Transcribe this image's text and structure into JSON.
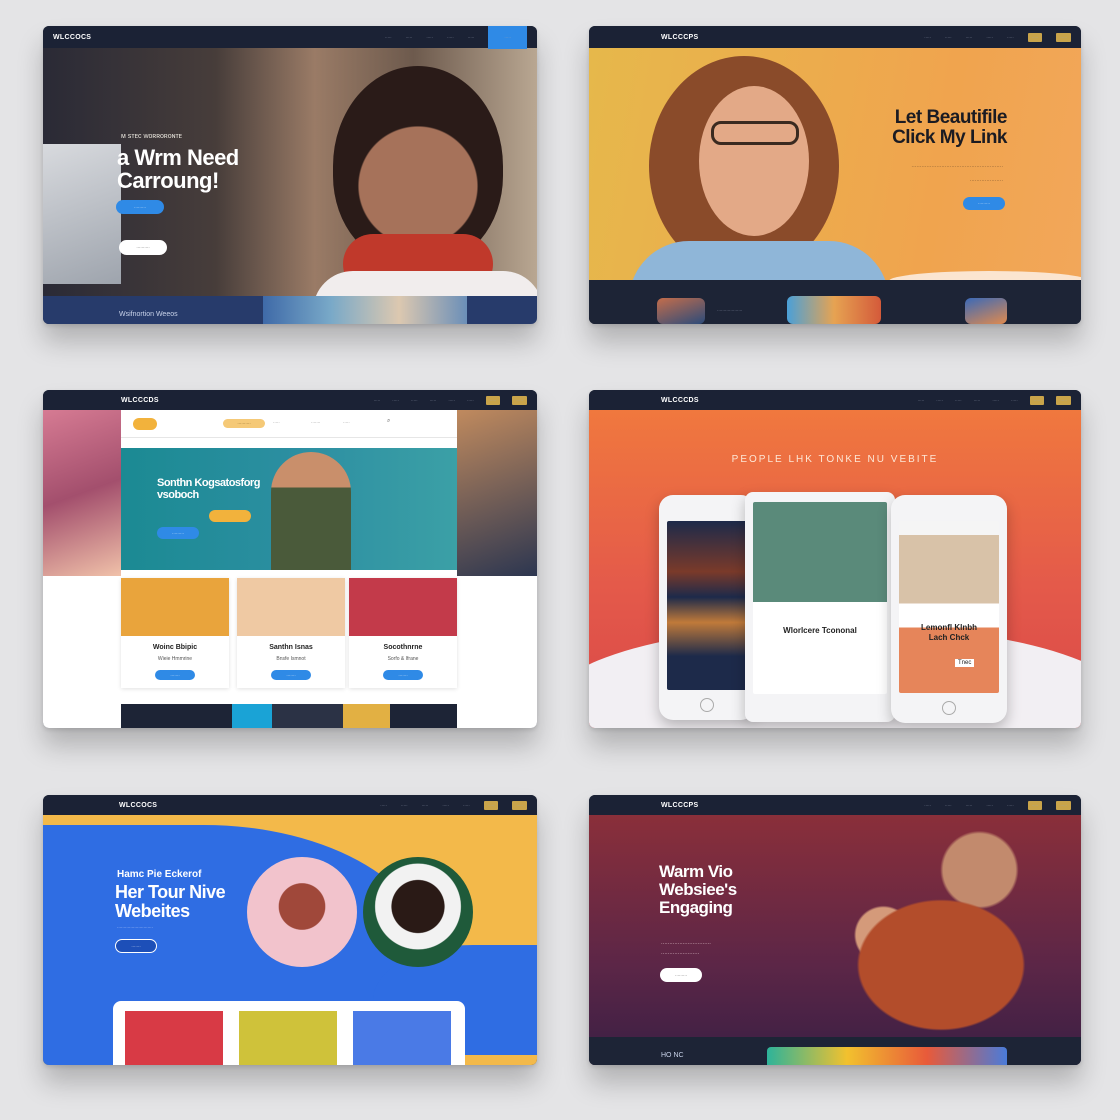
{
  "card1": {
    "logo": "WLCCOCS",
    "nav_links": [
      "·····",
      "·····",
      "·····",
      "·····",
      "·····"
    ],
    "nav_active": "·····",
    "eyebrow": "ᴍ ꜱᴛᴇᴄ ᴡᴏʀʀᴏʀᴏɴᴛᴇ",
    "headline": "a Wrm Need\nCarroung!",
    "cta_label": "·········",
    "secondary_label": "··········",
    "footer_caption": "Wsifnortion Weeos"
  },
  "card2": {
    "logo": "WLCCCPS",
    "nav_links": [
      "·····",
      "·····",
      "·····",
      "·····",
      "·····"
    ],
    "nav_buttons": [
      "·····",
      "·····"
    ],
    "headline": "Let Beautifile\nClick My Link",
    "sub_line_1": "·······················································",
    "sub_line_2": "····················",
    "cta_label": "·········",
    "footer_caption": "···················"
  },
  "card3": {
    "logo": "WLCCCDS",
    "nav_links": [
      "·····",
      "·····",
      "·····",
      "·····",
      "·····",
      "·····"
    ],
    "nav_buttons": [
      "·····",
      "·····"
    ],
    "inner_nav_links": [
      "··········",
      "·····",
      "·······",
      "·····"
    ],
    "hero_title": "Sonthn Kogsatosforg\nvsoboch",
    "hero_cta": "·········",
    "tiles": [
      {
        "title": "Woinc Bbipic",
        "subtitle": "Wieie Hmmrine",
        "button": "·······",
        "color": "#e9a43c"
      },
      {
        "title": "Santhn Isnas",
        "subtitle": "Bnsfe Ismnot",
        "button": "·······",
        "color": "#efc9a3"
      },
      {
        "title": "Socothnrne",
        "subtitle": "Sorfo & Ifrane",
        "button": "·······",
        "color": "#c33a4a"
      }
    ]
  },
  "card4": {
    "logo": "WLCCCDS",
    "nav_links": [
      "·····",
      "·····",
      "·····",
      "·····",
      "·····",
      "·····"
    ],
    "nav_buttons": [
      "·····",
      "·····"
    ],
    "headline": "PEOPLE LHK TONKE NU VEBITE",
    "center_title": "Wlorlcere Tcononal",
    "right_title": "Lemonfl Klnbh\nLach Chck",
    "right_tag": "Tnec"
  },
  "card5": {
    "logo": "WLCCOCS",
    "nav_links": [
      "·····",
      "·····",
      "·····",
      "·····",
      "·····"
    ],
    "nav_buttons": [
      "·····",
      "·····"
    ],
    "kicker": "Hamc Pie Eckerof",
    "headline": "Her Tour Nive\nWebeites",
    "sub": "···························",
    "cta_label": "·······"
  },
  "card6": {
    "logo": "WLCCCPS",
    "nav_links": [
      "·····",
      "·····",
      "·····",
      "·····",
      "·····"
    ],
    "nav_buttons": [
      "·····",
      "·····"
    ],
    "headline": "Warm Vio\nWebsiee's\nEngaging",
    "sub_line_1": "······························",
    "sub_line_2": "·······················",
    "cta_label": "·········",
    "footer_caption": "HO NC"
  }
}
